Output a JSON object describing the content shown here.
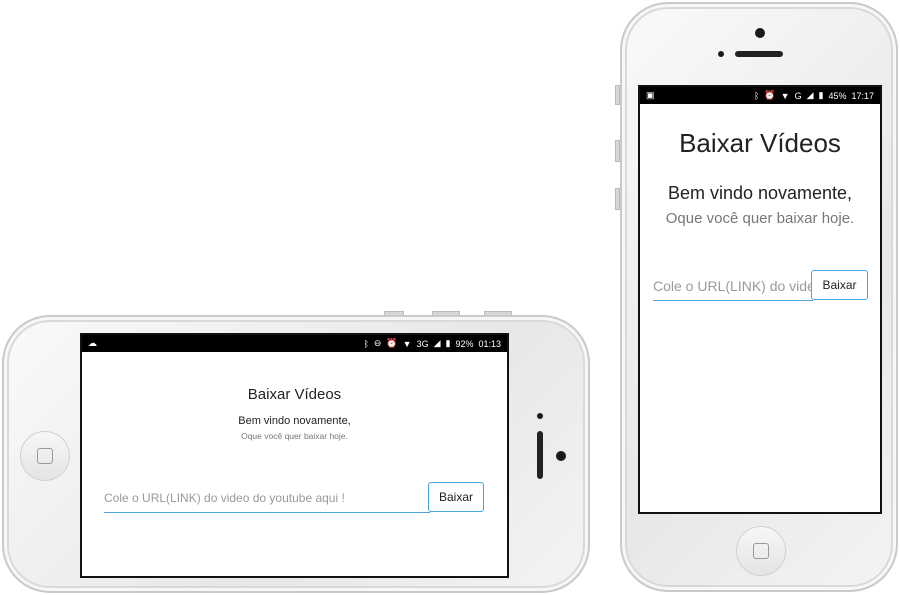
{
  "app": {
    "title": "Baixar Vídeos",
    "welcome": "Bem vindo novamente,",
    "subtitle": "Oque você quer baixar hoje.",
    "button_label": "Baixar"
  },
  "landscape": {
    "status": {
      "left_icon": "cloud-icon",
      "icons": [
        "bluetooth-icon",
        "do-not-disturb-icon",
        "alarm-icon",
        "wifi-icon"
      ],
      "network": "3G",
      "battery": "92%",
      "time": "01:13"
    },
    "input_placeholder": "Cole o URL(LINK) do video do youtube aqui !"
  },
  "portrait": {
    "status": {
      "left_icon": "image-icon",
      "icons": [
        "bluetooth-icon",
        "alarm-icon",
        "wifi-icon"
      ],
      "network": "G",
      "battery": "45%",
      "time": "17:17"
    },
    "input_placeholder": "Cole o URL(LINK) do video"
  },
  "colors": {
    "accent": "#4aa3df",
    "status_bar": "#000000"
  }
}
